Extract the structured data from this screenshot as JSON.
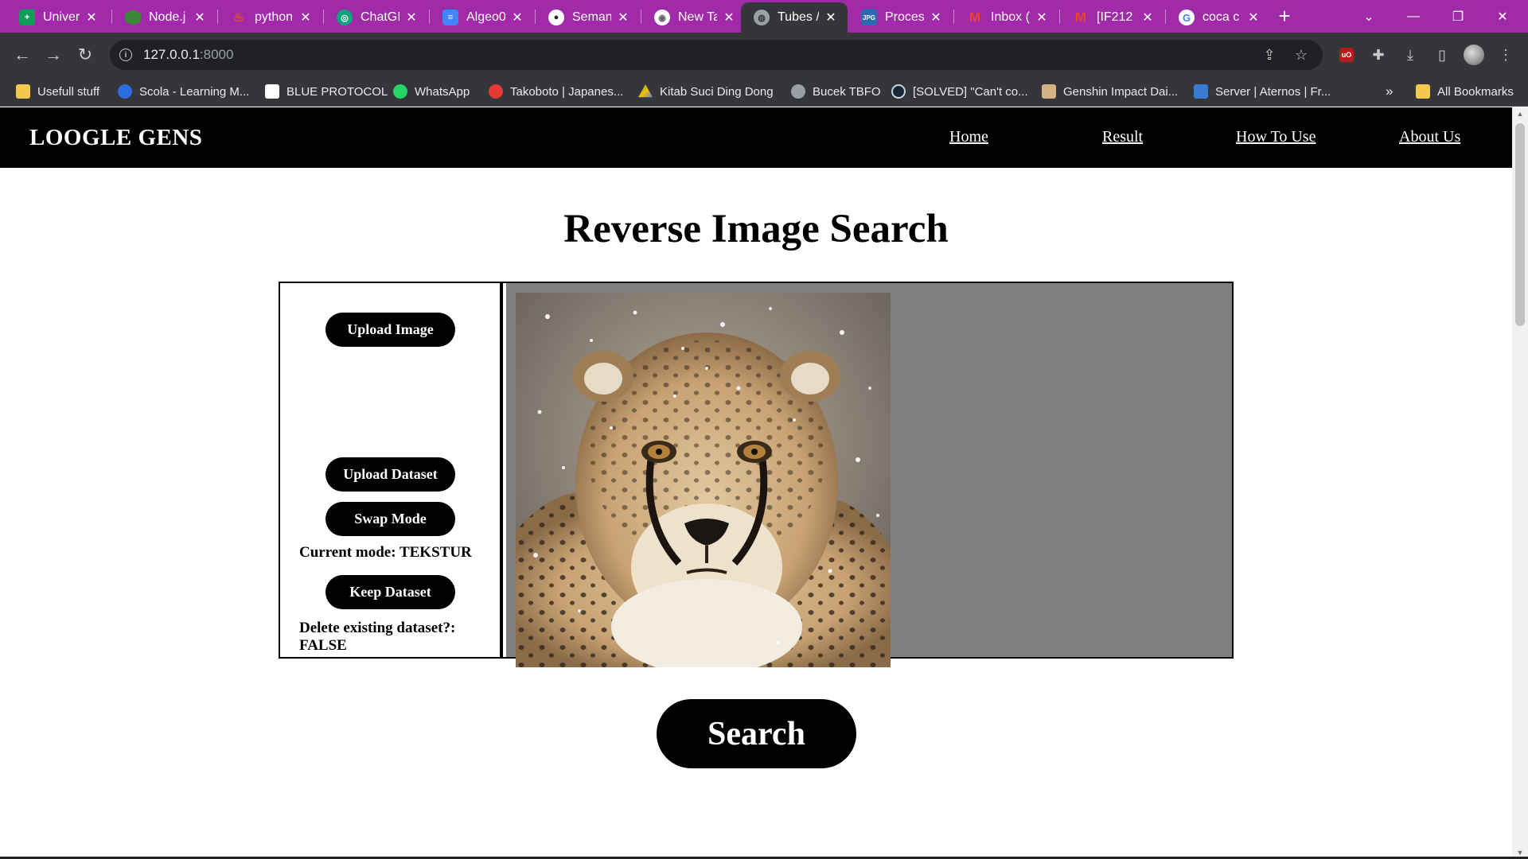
{
  "browser": {
    "tabs": [
      {
        "title": "Univer",
        "icon": "sheets-icon",
        "color": "#0f9d58"
      },
      {
        "title": "Node.j",
        "icon": "nodejs-icon",
        "color": "#3c873a"
      },
      {
        "title": "python",
        "icon": "python-icon",
        "color": "#e44d26"
      },
      {
        "title": "ChatGI",
        "icon": "chatgpt-icon",
        "color": "#10a37f"
      },
      {
        "title": "Algeo0",
        "icon": "docs-icon",
        "color": "#4285f4"
      },
      {
        "title": "Seman",
        "icon": "github-icon",
        "color": "#24292f"
      },
      {
        "title": "New Ta",
        "icon": "chrome-icon",
        "color": "#5f6368"
      },
      {
        "title": "Tubes /",
        "icon": "globe-icon",
        "color": "#9aa0a6"
      },
      {
        "title": "Proces",
        "icon": "jpg-icon",
        "color": "#2b6cb0"
      },
      {
        "title": "Inbox (",
        "icon": "gmail-icon",
        "color": "#ea4335"
      },
      {
        "title": "[IF212",
        "icon": "gmail-icon",
        "color": "#ea4335"
      },
      {
        "title": "coca c",
        "icon": "google-icon",
        "color": "#4285f4"
      }
    ],
    "address": {
      "host": "127.0.0.1",
      "port": ":8000"
    },
    "bookmarks": [
      {
        "label": "Usefull stuff",
        "icon": "folder-icon",
        "color": "#f2c94c"
      },
      {
        "label": "Scola - Learning M...",
        "icon": "scola-icon",
        "color": "#2d6cdf"
      },
      {
        "label": "BLUE PROTOCOL",
        "icon": "blue-protocol-icon",
        "color": "#ffffff"
      },
      {
        "label": "WhatsApp",
        "icon": "whatsapp-icon",
        "color": "#25d366"
      },
      {
        "label": "Takoboto | Japanes...",
        "icon": "takoboto-icon",
        "color": "#e53935"
      },
      {
        "label": "Kitab Suci Ding Dong",
        "icon": "drive-icon",
        "color": "#34a853"
      },
      {
        "label": "Bucek TBFO",
        "icon": "globe-icon",
        "color": "#9aa0a6"
      },
      {
        "label": "[SOLVED] \"Can't co...",
        "icon": "steam-icon",
        "color": "#1b2838"
      },
      {
        "label": "Genshin Impact Dai...",
        "icon": "genshin-icon",
        "color": "#d4b483"
      },
      {
        "label": "Server | Aternos | Fr...",
        "icon": "aternos-icon",
        "color": "#3a7bd5"
      }
    ],
    "overflow_label": "»",
    "all_bookmarks_label": "All Bookmarks"
  },
  "site": {
    "brand": "LOOGLE GENS",
    "nav": [
      {
        "label": "Home"
      },
      {
        "label": "Result"
      },
      {
        "label": "How To Use"
      },
      {
        "label": "About Us"
      }
    ],
    "title": "Reverse Image Search",
    "controls": {
      "upload_image": "Upload Image",
      "upload_dataset": "Upload Dataset",
      "swap_mode": "Swap Mode",
      "current_mode": "Current mode: TEKSTUR",
      "keep_dataset": "Keep Dataset",
      "delete_dataset_label": "Delete existing dataset?:",
      "delete_dataset_value": "FALSE"
    },
    "preview_subject": "cheetah-photo",
    "search_label": "Search"
  },
  "colors": {
    "tabbar": "#a12aa8",
    "toolbar": "#35363a",
    "site_nav": "#000000",
    "preview_bg": "#808080",
    "button": "#000000"
  }
}
